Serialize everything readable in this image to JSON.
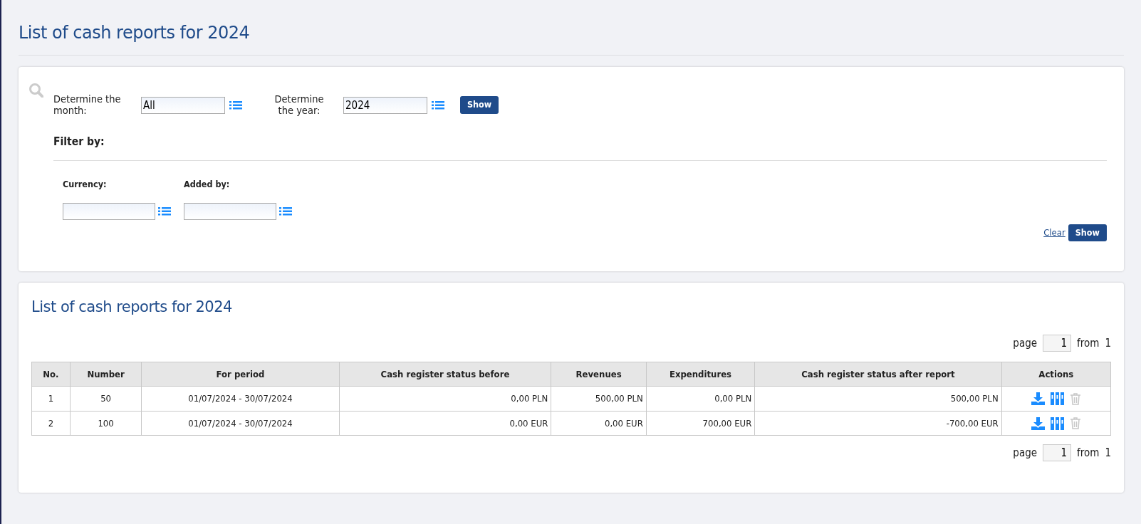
{
  "page_title": "List of cash reports for 2024",
  "filters": {
    "month": {
      "label": "Determine the month:",
      "value": "All"
    },
    "year": {
      "label": "Determine the year:",
      "value": "2024"
    },
    "show_button": "Show",
    "filter_by": {
      "heading": "Filter by:",
      "fields": [
        {
          "label": "Currency:"
        },
        {
          "label": "Added by:"
        }
      ],
      "clear_link": "Clear",
      "show_button": "Show"
    }
  },
  "list": {
    "title": "List of cash reports for 2024",
    "pager_top": {
      "label": "page",
      "value": "1",
      "from_label": "from",
      "total": "1"
    },
    "columns": [
      "No.",
      "Number",
      "For period",
      "Cash register status before",
      "Revenues",
      "Expenditures",
      "Cash register status after report",
      "Actions"
    ],
    "rows": [
      {
        "cells": [
          "1",
          "50",
          "01/07/2024 - 30/07/2024",
          "0,00 PLN",
          "500,00 PLN",
          "0,00 PLN",
          "500,00 PLN"
        ],
        "delete_disabled": true
      },
      {
        "cells": [
          "2",
          "100",
          "01/07/2024 - 30/07/2024",
          "0,00 EUR",
          "0,00 EUR",
          "700,00 EUR",
          "-700,00 EUR"
        ],
        "delete_disabled": true
      }
    ],
    "pager_bottom": {
      "label": "page",
      "value": "1",
      "from_label": "from",
      "total": "1"
    }
  }
}
